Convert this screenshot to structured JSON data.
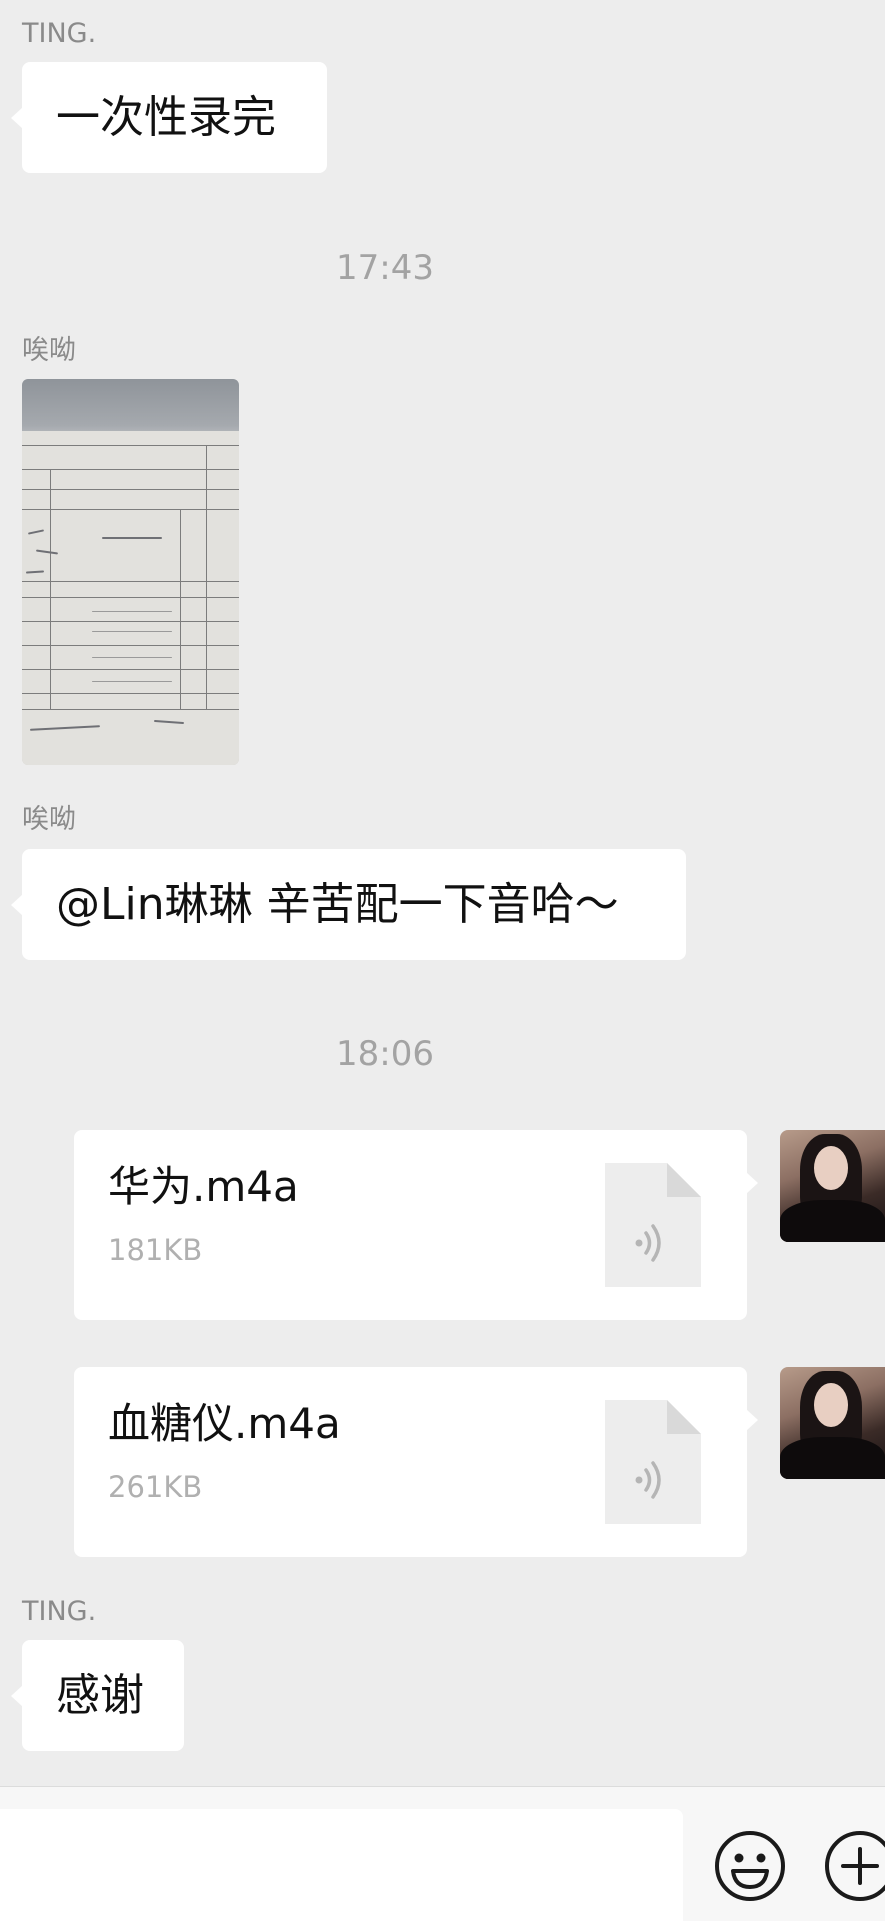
{
  "messages": [
    {
      "sender": "TING.",
      "text": "一次性录完"
    },
    {
      "timestamp": "17:43"
    },
    {
      "sender": "唉呦",
      "type": "image"
    },
    {
      "sender": "唉呦",
      "text": "@Lin琳琳 辛苦配一下音哈～"
    },
    {
      "timestamp": "18:06"
    },
    {
      "type": "file",
      "file_name": "华为.m4a",
      "file_size": "181KB",
      "icon": "audio-file-icon"
    },
    {
      "type": "file",
      "file_name": "血糖仪.m4a",
      "file_size": "261KB",
      "icon": "audio-file-icon"
    },
    {
      "sender": "TING.",
      "text": "感谢"
    }
  ],
  "input_bar": {
    "placeholder": "",
    "emoji_icon": "smiley-icon",
    "plus_icon": "plus-circle-icon"
  }
}
